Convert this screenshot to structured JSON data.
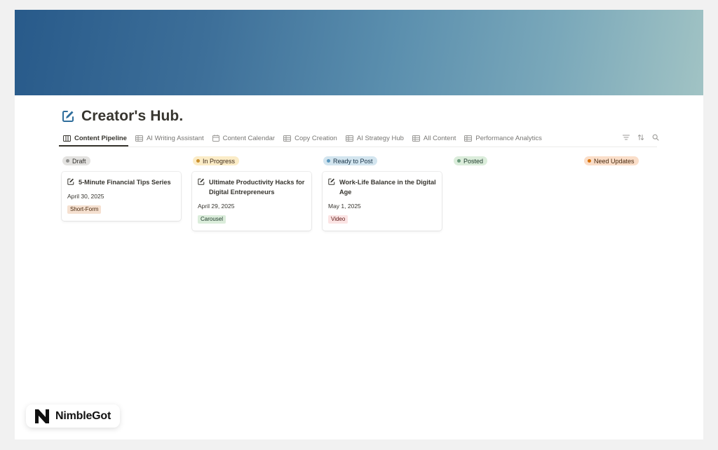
{
  "page": {
    "title": "Creator's Hub.",
    "cover_colors": [
      "#285a8a",
      "#5b8fae",
      "#a1c3c4"
    ]
  },
  "tabs": [
    {
      "label": "Content Pipeline",
      "icon": "board-icon",
      "active": true
    },
    {
      "label": "AI Writing Assistant",
      "icon": "table-icon",
      "active": false
    },
    {
      "label": "Content Calendar",
      "icon": "calendar-icon",
      "active": false
    },
    {
      "label": "Copy Creation",
      "icon": "table-icon",
      "active": false
    },
    {
      "label": "AI Strategy Hub",
      "icon": "table-icon",
      "active": false
    },
    {
      "label": "All Content",
      "icon": "table-icon",
      "active": false
    },
    {
      "label": "Performance Analytics",
      "icon": "table-icon",
      "active": false
    }
  ],
  "tools": [
    "filter-icon",
    "sort-icon",
    "search-icon"
  ],
  "columns": [
    {
      "status": "Draft",
      "pill_bg": "#e3e2e0",
      "dot": "#91918e",
      "text": "#32302c",
      "cards": [
        {
          "title": "5-Minute Financial Tips Series",
          "date": "April 30, 2025",
          "tag": "Short-Form",
          "tag_bg": "#f5e0d0",
          "tag_text": "#49290e"
        }
      ]
    },
    {
      "status": "In Progress",
      "pill_bg": "#fbecc7",
      "dot": "#cb912f",
      "text": "#402c1b",
      "cards": [
        {
          "title": "Ultimate Productivity Hacks for Digital Entrepreneurs",
          "date": "April 29, 2025",
          "tag": "Carousel",
          "tag_bg": "#dbeddb",
          "tag_text": "#1c3829"
        }
      ]
    },
    {
      "status": "Ready to Post",
      "pill_bg": "#d3e5ef",
      "dot": "#5b97bd",
      "text": "#183347",
      "cards": [
        {
          "title": "Work-Life Balance in the Digital Age",
          "date": "May 1, 2025",
          "tag": "Video",
          "tag_bg": "#fbe4e4",
          "tag_text": "#5d1715"
        }
      ]
    },
    {
      "status": "Posted",
      "pill_bg": "#dbeddb",
      "dot": "#6c9b7d",
      "text": "#1c3829",
      "cards": []
    },
    {
      "status": "Need Updates",
      "pill_bg": "#fadec9",
      "dot": "#d9730d",
      "text": "#49290e",
      "cards": []
    }
  ],
  "brand": {
    "name": "NimbleGot",
    "logo_letter": "N"
  }
}
